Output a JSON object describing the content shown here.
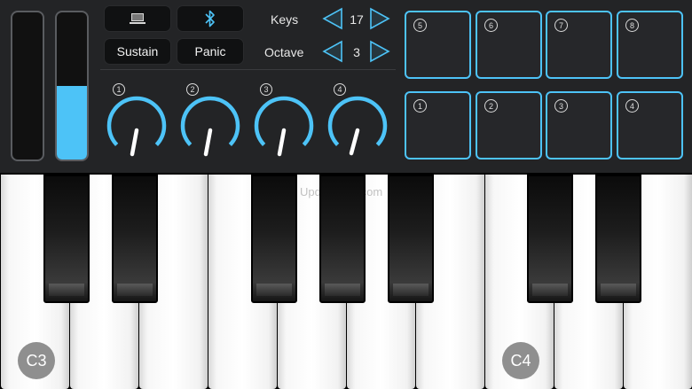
{
  "colors": {
    "accent": "#4dc3f7",
    "panel": "#232426",
    "button": "#101112"
  },
  "sliders": [
    {
      "name": "left",
      "level": 0
    },
    {
      "name": "right",
      "level": 0.5
    }
  ],
  "buttons": {
    "keyboard_icon": "keyboard-icon",
    "bluetooth_icon": "bluetooth-icon",
    "sustain": "Sustain",
    "panic": "Panic"
  },
  "controls": {
    "keys_label": "Keys",
    "keys_value": "17",
    "octave_label": "Octave",
    "octave_value": "3"
  },
  "knobs": [
    {
      "number": "1",
      "value": 0.2
    },
    {
      "number": "2",
      "value": 0.2
    },
    {
      "number": "3",
      "value": 0.2
    },
    {
      "number": "4",
      "value": 0.25
    }
  ],
  "pads_top": [
    "5",
    "6",
    "7",
    "8"
  ],
  "pads_bottom": [
    "1",
    "2",
    "3",
    "4"
  ],
  "keyboard": {
    "watermark": "UpdateStar.com",
    "note_left": "C3",
    "note_right": "C4"
  }
}
